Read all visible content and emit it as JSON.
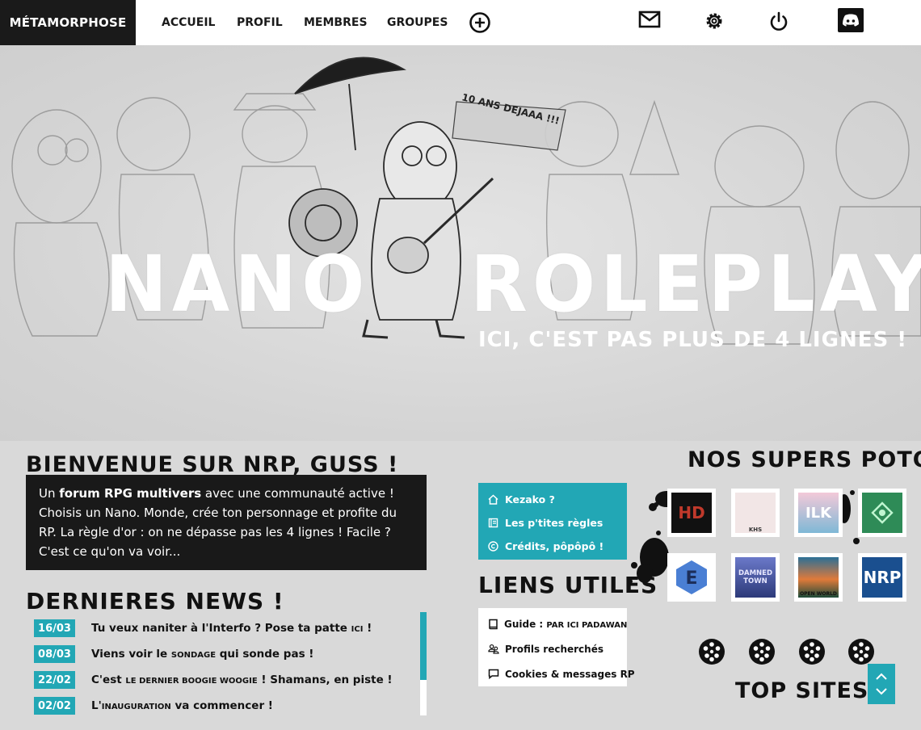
{
  "nav": {
    "brand": "MÉTAMORPHOSE",
    "links": [
      "ACCUEIL",
      "PROFIL",
      "MEMBRES",
      "GROUPES"
    ],
    "icons": [
      "add-circle-icon",
      "mail-icon",
      "gear-icon",
      "power-icon",
      "discord-icon"
    ]
  },
  "hero": {
    "title_part1": "NANO",
    "title_part2": "ROLEPLAY",
    "subtitle": "ICI, C'EST PAS PLUS DE 4 LIGNES !",
    "bubble": "10 ANS DEJAAA !!!"
  },
  "welcome": {
    "title": "BIENVENUE SUR NRP, GUSS !",
    "text_prefix": "Un ",
    "text_bold": "forum RPG multivers",
    "text_suffix": " avec une communauté active ! Choisis un Nano. Monde, crée ton personnage et profite du RP. La règle d'or : on ne dépasse pas les 4 lignes ! Facile ? C'est ce qu'on va voir..."
  },
  "news": {
    "title": "DERNIERES NEWS !",
    "items": [
      {
        "date": "16/03",
        "a": "Tu veux naniter à l'Interfo ? Pose ta patte ",
        "sc": "ICI",
        "b": " !"
      },
      {
        "date": "08/03",
        "a": "Viens voir le ",
        "sc": "SONDAGE",
        "b": " qui sonde pas !"
      },
      {
        "date": "22/02",
        "a": "C'est ",
        "sc": "LE DERNIER BOOGIE WOOGIE",
        "b": " ! Shamans, en piste !"
      },
      {
        "date": "02/02",
        "a": "L'",
        "sc": "INAUGURATION",
        "b": " va commencer !"
      }
    ]
  },
  "teal_menu": {
    "items": [
      {
        "label": "Kezako ?",
        "icon": "home-icon"
      },
      {
        "label": "Les p'tites règles",
        "icon": "book-icon"
      },
      {
        "label": "Crédits, pôpôpô !",
        "icon": "copyright-icon"
      }
    ]
  },
  "links": {
    "title": "LIENS UTILES",
    "items": [
      {
        "label_a": "Guide : ",
        "label_sc": "PAR ICI PADAWAN",
        "icon": "book-icon"
      },
      {
        "label_a": "Profils recherchés",
        "label_sc": "",
        "icon": "users-icon"
      },
      {
        "label_a": "Cookies & messages RP",
        "label_sc": "",
        "icon": "chat-icon"
      }
    ]
  },
  "partners": {
    "title": "NOS SUPERS POTOS",
    "logos": [
      {
        "text": "HD",
        "bg": "#111111",
        "fg": "#c0392b"
      },
      {
        "text": "KHS",
        "bg": "#f2e6e6",
        "fg": "#333333"
      },
      {
        "text": "ILK",
        "bg": "#7fb8d6",
        "fg": "#ffffff"
      },
      {
        "text": "",
        "bg": "#2e8b57",
        "fg": "#ffffff"
      },
      {
        "text": "E",
        "bg": "#4a7fd4",
        "fg": "#1c2e5a"
      },
      {
        "text": "DAMNED TOWN",
        "bg": "#3b4a8a",
        "fg": "#e8e8ff"
      },
      {
        "text": "OPEN WORLD",
        "bg": "#e07a3a",
        "fg": "#111111"
      },
      {
        "text": "NRP",
        "bg": "#1a4f8f",
        "fg": "#ffffff"
      }
    ]
  },
  "topsites": {
    "title": "TOP SITES"
  },
  "colors": {
    "accent": "#22a7b5",
    "dark": "#191919"
  }
}
